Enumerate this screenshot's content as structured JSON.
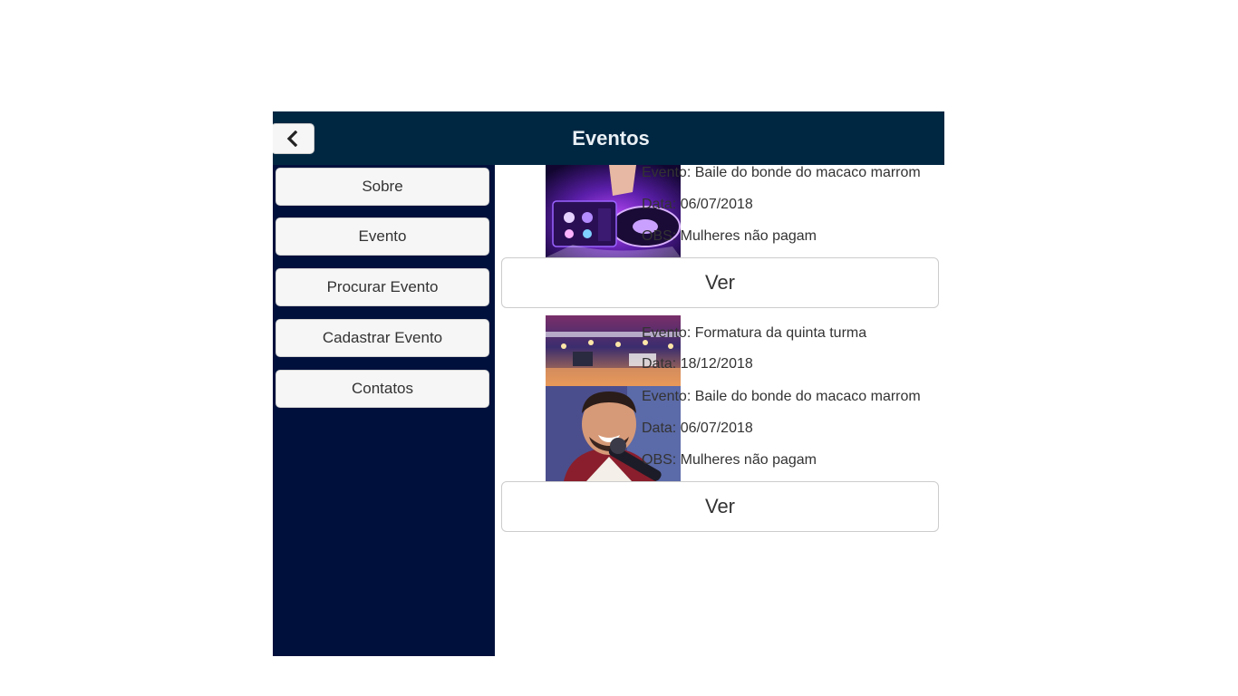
{
  "header": {
    "title": "Eventos"
  },
  "sidebar": {
    "items": [
      {
        "label": "Sobre"
      },
      {
        "label": "Evento"
      },
      {
        "label": "Procurar Evento"
      },
      {
        "label": "Cadastrar Evento"
      },
      {
        "label": "Contatos"
      }
    ]
  },
  "events": [
    {
      "evento": "Evento: Baile do bonde do macaco marrom",
      "data": "Data: 06/07/2018",
      "obs": "OBS: Mulheres não pagam",
      "ver_label": "Ver"
    },
    {
      "evento": "Evento: Formatura da quinta turma",
      "data": "Data: 18/12/2018"
    },
    {
      "evento": "Evento: Baile do bonde do macaco marrom",
      "data": "Data: 06/07/2018",
      "obs": "OBS: Mulheres não pagam",
      "ver_label": "Ver"
    }
  ],
  "colors": {
    "header_bg": "#002742",
    "sidebar_bg": "#00103c",
    "button_bg": "#f6f6f6"
  },
  "icons": {
    "back": "chevron-left-icon"
  }
}
